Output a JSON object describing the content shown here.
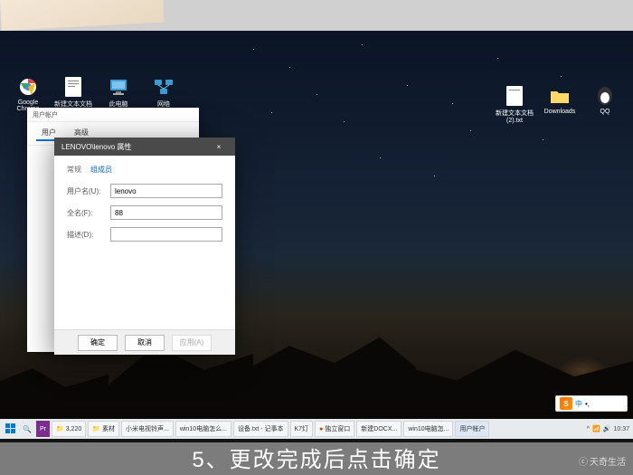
{
  "desktop": {
    "left_icons": [
      {
        "label": "Google Chrome",
        "icon": "chrome"
      },
      {
        "label": "新建文本文档",
        "icon": "txt"
      },
      {
        "label": "此电脑",
        "icon": "pc"
      },
      {
        "label": "网络",
        "icon": "net"
      }
    ],
    "right_icons": [
      {
        "label": "新建文本文档(2).txt"
      },
      {
        "label": "Downloads"
      },
      {
        "label": "QQ"
      }
    ]
  },
  "window1": {
    "title": "用户帐户",
    "tabs": [
      "用户",
      "高级"
    ]
  },
  "dialog": {
    "title": "LENOVO\\lenovo 属性",
    "meta_left": "常规",
    "meta_right": "组成员",
    "fields": {
      "username_label": "用户名(U):",
      "username_value": "lenovo",
      "fullname_label": "全名(F):",
      "fullname_value": "88",
      "desc_label": "描述(D):",
      "desc_value": ""
    },
    "buttons": {
      "ok": "确定",
      "cancel": "取消",
      "apply": "应用(A)"
    }
  },
  "taskbar": {
    "items": [
      {
        "label": "3,220"
      },
      {
        "label": "素材"
      },
      {
        "label": "小米电视铃声..."
      },
      {
        "label": "win10电脑怎么..."
      },
      {
        "label": "设备.txt - 记事本"
      },
      {
        "label": "K7灯"
      },
      {
        "label": "独立窗口"
      },
      {
        "label": "新建DOCX..."
      },
      {
        "label": "win10电脑怎..."
      },
      {
        "label": "用户帐户"
      }
    ],
    "tray_time": "10:37"
  },
  "ime": {
    "logo": "S",
    "lang": "中",
    "punct": "•,"
  },
  "caption": "5、更改完成后点击确定",
  "watermark": "天奇生活"
}
